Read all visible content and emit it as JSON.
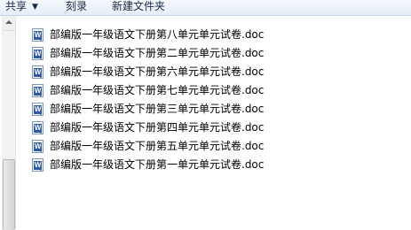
{
  "toolbar": {
    "share_label": "共享",
    "burn_label": "刻录",
    "new_folder_label": "新建文件夹"
  },
  "files": [
    {
      "name": "部编版一年级语文下册第八单元单元试卷.doc",
      "icon": "word-document-icon"
    },
    {
      "name": "部编版一年级语文下册第二单元单元试卷.doc",
      "icon": "word-document-icon"
    },
    {
      "name": "部编版一年级语文下册第六单元单元试卷.doc",
      "icon": "word-document-icon"
    },
    {
      "name": "部编版一年级语文下册第七单元单元试卷.doc",
      "icon": "word-document-icon"
    },
    {
      "name": "部编版一年级语文下册第三单元单元试卷.doc",
      "icon": "word-document-icon"
    },
    {
      "name": "部编版一年级语文下册第四单元单元试卷.doc",
      "icon": "word-document-icon"
    },
    {
      "name": "部编版一年级语文下册第五单元单元试卷.doc",
      "icon": "word-document-icon"
    },
    {
      "name": "部编版一年级语文下册第一单元单元试卷.doc",
      "icon": "word-document-icon"
    }
  ]
}
